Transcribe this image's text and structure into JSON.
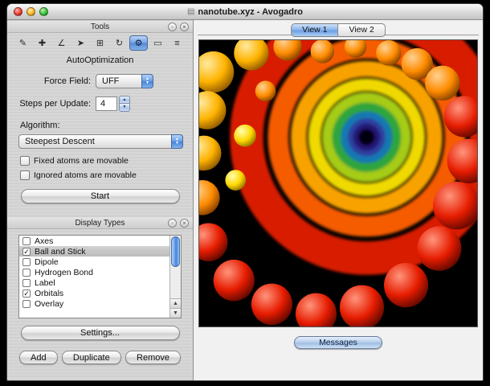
{
  "window": {
    "title": "nanotube.xyz - Avogadro"
  },
  "icons": {
    "document": "▤",
    "detach": "◦",
    "close": "×",
    "popup_up": "▲",
    "popup_down": "▼",
    "step_up": "▲",
    "step_down": "▼",
    "scroll_up": "▲",
    "scroll_down": "▼"
  },
  "tools_panel": {
    "title": "Tools",
    "toolbar": [
      {
        "name": "draw-tool",
        "glyph": "✎"
      },
      {
        "name": "navigate-tool",
        "glyph": "✚"
      },
      {
        "name": "bond-centric-tool",
        "glyph": "∠"
      },
      {
        "name": "selection-tool",
        "glyph": "➤"
      },
      {
        "name": "manipulate-tool",
        "glyph": "⊞"
      },
      {
        "name": "auto-rotate-tool",
        "glyph": "↻"
      },
      {
        "name": "auto-optimize-tool",
        "glyph": "⚙",
        "active": true
      },
      {
        "name": "measure-tool",
        "glyph": "▭"
      },
      {
        "name": "align-tool",
        "glyph": "≡"
      }
    ],
    "autoopt": {
      "title": "AutoOptimization",
      "force_field_label": "Force Field:",
      "force_field_value": "UFF",
      "steps_label": "Steps per Update:",
      "steps_value": "4",
      "algorithm_label": "Algorithm:",
      "algorithm_value": "Steepest Descent",
      "checkbox_fixed": "Fixed atoms are movable",
      "checkbox_fixed_checked": "",
      "checkbox_ignored": "Ignored atoms are movable",
      "checkbox_ignored_checked": "",
      "start_label": "Start"
    }
  },
  "display_panel": {
    "title": "Display Types",
    "items": [
      {
        "label": "Axes",
        "check": "",
        "selected": false
      },
      {
        "label": "Ball and Stick",
        "check": "✓",
        "selected": true
      },
      {
        "label": "Dipole",
        "check": "",
        "selected": false
      },
      {
        "label": "Hydrogen Bond",
        "check": "",
        "selected": false
      },
      {
        "label": "Label",
        "check": "",
        "selected": false
      },
      {
        "label": "Orbitals",
        "check": "✓",
        "selected": false
      },
      {
        "label": "Overlay",
        "check": "",
        "selected": false
      }
    ],
    "settings_label": "Settings..."
  },
  "bottom_buttons": {
    "add": "Add",
    "duplicate": "Duplicate",
    "remove": "Remove"
  },
  "view": {
    "tabs": [
      {
        "label": "View 1",
        "active": true
      },
      {
        "label": "View 2",
        "active": false
      }
    ],
    "messages_label": "Messages"
  },
  "colors": {
    "aqua_accent": "#4a84d8",
    "selection_grey": "#c6c6c6",
    "viewport_bg": "#000000"
  }
}
